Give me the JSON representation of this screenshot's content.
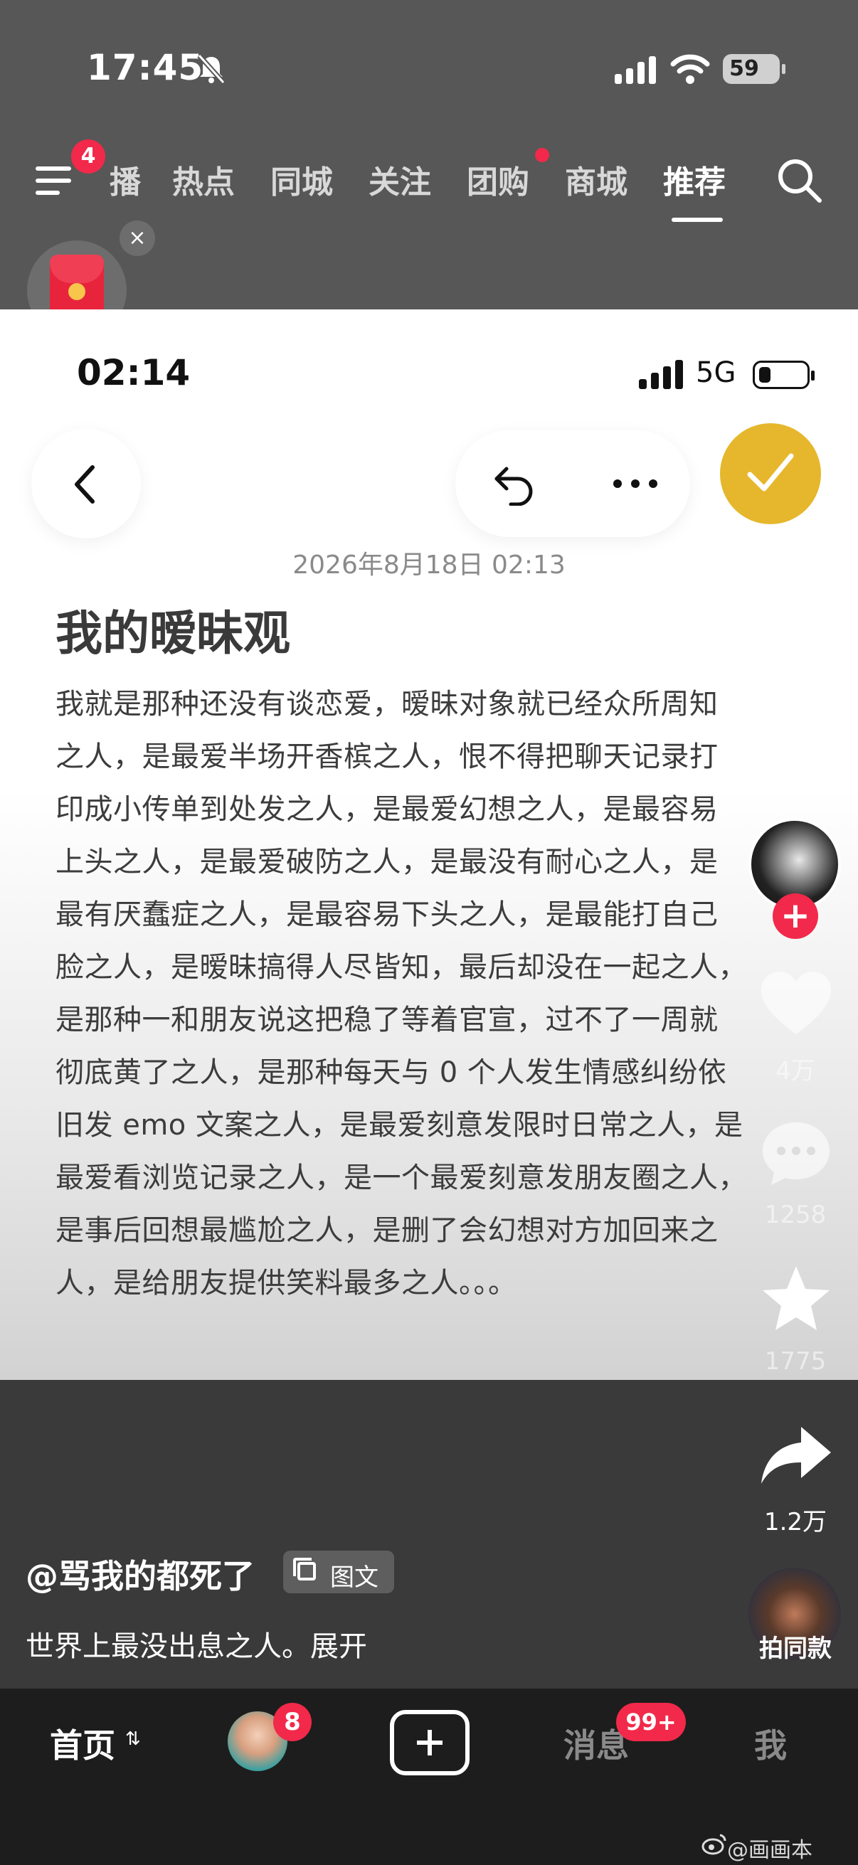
{
  "status_bar": {
    "time": "17:45",
    "battery": "59"
  },
  "top_nav": {
    "menu_badge": "4",
    "tabs": [
      "播",
      "热点",
      "同城",
      "关注",
      "团购",
      "商城",
      "推荐"
    ],
    "active_tab": "推荐",
    "close_glyph": "×"
  },
  "post_image": {
    "status_bar": {
      "time": "02:14",
      "network": "5G"
    },
    "date": "2026年8月18日 02:13",
    "title": "我的暧昧观",
    "body_lines": [
      "我就是那种还没有谈恋爱，暧昧对象就已经众所周知",
      "之人，是最爱半场开香槟之人，恨不得把聊天记录打",
      "印成小传单到处发之人，是最爱幻想之人，是最容易",
      "上头之人，是最爱破防之人，是最没有耐心之人，是",
      "最有厌蠢症之人，是最容易下头之人，是最能打自己",
      "脸之人，是暧昧搞得人尽皆知，最后却没在一起之人，",
      "是那种一和朋友说这把稳了等着官宣，过不了一周就",
      "彻底黄了之人，是那种每天与 0 个人发生情感纠纷依",
      "旧发 emo 文案之人，是最爱刻意发限时日常之人，是",
      "最爱看浏览记录之人，是一个最爱刻意发朋友圈之人，",
      "是事后回想最尴尬之人，是删了会幻想对方加回来之",
      "人，是给朋友提供笑料最多之人。。。"
    ]
  },
  "right_rail": {
    "follow_plus": "+",
    "likes": "4万",
    "comments": "1258",
    "favorites": "1775",
    "shares": "1.2万",
    "same_style": "拍同款"
  },
  "caption": {
    "author": "@骂我的都死了",
    "type_badge": "图文",
    "text": "世界上最没出息之人。展开"
  },
  "bottom_tabs": {
    "home": "首页",
    "home_arrows": "⇅",
    "friend_badge": "8",
    "messages": "消息",
    "messages_badge": "99+",
    "me": "我"
  },
  "watermark": "@画画本",
  "colors": {
    "accent_red": "#f2294a",
    "check_gold": "#e6b72c",
    "tab_bg": "#1d1d1d"
  }
}
